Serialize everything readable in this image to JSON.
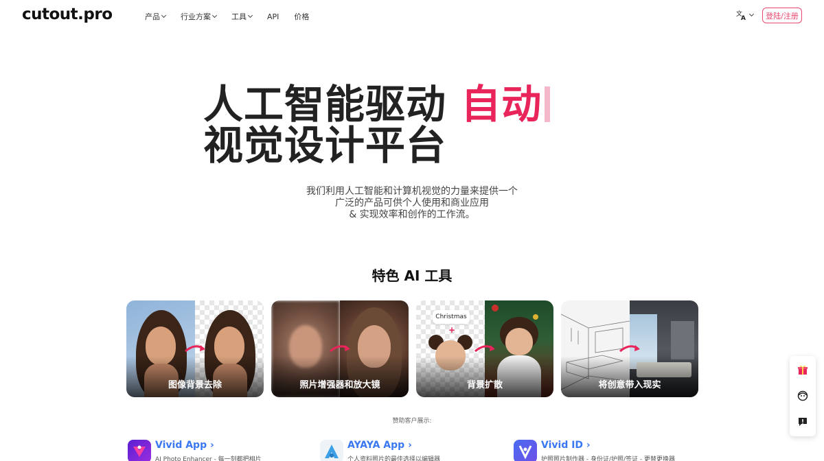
{
  "header": {
    "logo": "cutout.pro",
    "nav": [
      {
        "label": "产品",
        "dropdown": true
      },
      {
        "label": "行业方案",
        "dropdown": true
      },
      {
        "label": "工具",
        "dropdown": true
      },
      {
        "label": "API",
        "dropdown": false
      },
      {
        "label": "价格",
        "dropdown": false
      }
    ],
    "language_icon": "translate-icon",
    "login_label": "登陆/注册"
  },
  "hero": {
    "title_line1": "人工智能驱动 ",
    "title_accent": "自动",
    "title_line2": "视觉设计平台",
    "subtitle_line1": "我们利用人工智能和计算机视觉的力量来提供一个",
    "subtitle_line2": "广泛的产品可供个人使用和商业应用",
    "subtitle_line3": "& 实现效率和创作的工作流。"
  },
  "tools": {
    "title": "特色 AI 工具",
    "cards": [
      {
        "label": "图像背景去除"
      },
      {
        "label": "照片增强器和放大镜"
      },
      {
        "label": "背景扩散",
        "tag": "Christmas",
        "plus": "+"
      },
      {
        "label": "将创意带入现实"
      }
    ]
  },
  "sponsors": {
    "label": "赞助客户展示:",
    "apps": [
      {
        "name": "Vivid App",
        "desc": "AI Photo Enhancer - 每一刻都把相片"
      },
      {
        "name": "AYAYA App",
        "desc": "个人资料照片的最佳选择以编辑器"
      },
      {
        "name": "Vivid ID",
        "desc": "护照照片制作器 - 身份证/护照/签证 - 更替更换器"
      }
    ]
  },
  "side_panel": {
    "icons": [
      "gift-icon",
      "support-face-icon",
      "feedback-icon"
    ]
  },
  "colors": {
    "accent": "#e8245a",
    "login_border": "#e8476f",
    "app_link": "#3a78f2"
  }
}
